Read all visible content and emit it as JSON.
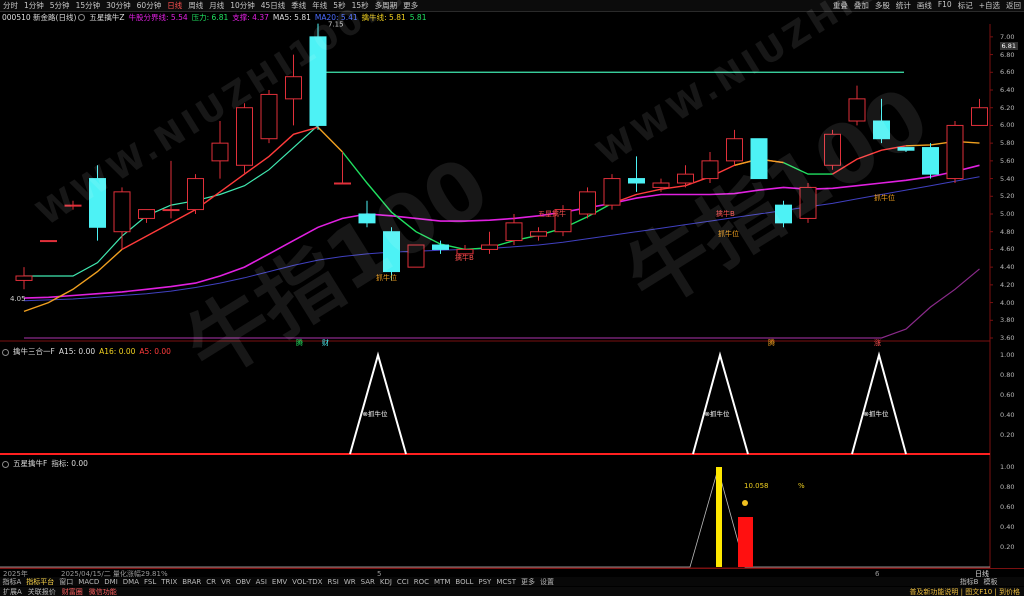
{
  "topbar": {
    "left_items": [
      "分时",
      "1分钟",
      "5分钟",
      "15分钟",
      "30分钟",
      "60分钟",
      "日线",
      "周线",
      "月线",
      "10分钟",
      "45日线",
      "季线",
      "年线",
      "5秒",
      "15秒",
      "多周期",
      "更多"
    ],
    "active": "日线",
    "right_items": [
      "重叠",
      "叠加",
      "多股",
      "统计",
      "画线",
      "F10",
      "标记",
      "+自选",
      "返回"
    ]
  },
  "info": {
    "code_name": "000510 新金路(日线)",
    "indicator_name": "五星擒牛Z",
    "resistance_label": "牛股分界线: 5.54",
    "pressure_label": "压力: 6.81",
    "support_label": "支撑: 4.37",
    "ma5_label": "MA5: 5.81",
    "ma20_label": "MA20: 5.41",
    "bull_line_label": "擒牛线: 5.81",
    "last_label": "5.81"
  },
  "colors": {
    "up": "#ff3b3b",
    "down": "#4df2f5",
    "green": "#20e060",
    "teal": "#40e8b0",
    "magenta": "#e020e0",
    "blue": "#4040c0",
    "orange": "#f0a020",
    "purple": "#8a2a8a"
  },
  "main_axis": [
    "7.00",
    "6.80",
    "6.60",
    "6.40",
    "6.20",
    "6.00",
    "5.80",
    "5.60",
    "5.40",
    "5.20",
    "5.00",
    "4.80",
    "4.60",
    "4.40",
    "4.20",
    "4.00",
    "3.80",
    "3.60"
  ],
  "price_badge": "6.81",
  "high_label": "7.15",
  "low_label": "4.05",
  "chart_labels": {
    "buy1": "抓牛位",
    "buy2": "抓牛位",
    "buy3": "抓牛位",
    "bull_b1": "擒牛B",
    "bull_b2": "擒牛B",
    "star": "五星擒牛"
  },
  "markers": [
    "腾",
    "财",
    "腾",
    "涨"
  ],
  "chart_data": [
    {
      "type": "candlestick",
      "title": "五星擒牛Z",
      "ylim": [
        3.6,
        7.1
      ],
      "candles": [
        {
          "o": 4.25,
          "h": 4.4,
          "l": 4.15,
          "c": 4.3
        },
        {
          "o": 4.7,
          "h": 4.7,
          "l": 4.7,
          "c": 4.7
        },
        {
          "o": 5.1,
          "h": 5.15,
          "l": 5.05,
          "c": 5.1
        },
        {
          "o": 5.4,
          "h": 5.55,
          "l": 4.7,
          "c": 4.85
        },
        {
          "o": 4.8,
          "h": 5.3,
          "l": 4.6,
          "c": 5.25
        },
        {
          "o": 4.95,
          "h": 5.0,
          "l": 4.9,
          "c": 5.05
        },
        {
          "o": 5.05,
          "h": 5.6,
          "l": 4.95,
          "c": 5.05
        },
        {
          "o": 5.05,
          "h": 5.45,
          "l": 5.0,
          "c": 5.4
        },
        {
          "o": 5.6,
          "h": 6.05,
          "l": 5.4,
          "c": 5.8
        },
        {
          "o": 5.55,
          "h": 6.25,
          "l": 5.45,
          "c": 6.2
        },
        {
          "o": 5.85,
          "h": 6.4,
          "l": 5.8,
          "c": 6.35
        },
        {
          "o": 6.3,
          "h": 6.8,
          "l": 6.0,
          "c": 6.55
        },
        {
          "o": 7.0,
          "h": 7.15,
          "l": 5.95,
          "c": 6.0
        },
        {
          "o": 5.35,
          "h": 5.7,
          "l": 5.35,
          "c": 5.35
        },
        {
          "o": 5.0,
          "h": 5.15,
          "l": 4.85,
          "c": 4.9
        },
        {
          "o": 4.8,
          "h": 4.85,
          "l": 4.25,
          "c": 4.35
        },
        {
          "o": 4.4,
          "h": 4.65,
          "l": 4.4,
          "c": 4.65
        },
        {
          "o": 4.65,
          "h": 4.7,
          "l": 4.55,
          "c": 4.6
        },
        {
          "o": 4.55,
          "h": 4.65,
          "l": 4.55,
          "c": 4.6
        },
        {
          "o": 4.6,
          "h": 4.8,
          "l": 4.55,
          "c": 4.65
        },
        {
          "o": 4.7,
          "h": 5.0,
          "l": 4.65,
          "c": 4.9
        },
        {
          "o": 4.75,
          "h": 4.85,
          "l": 4.7,
          "c": 4.8
        },
        {
          "o": 4.8,
          "h": 5.1,
          "l": 4.75,
          "c": 5.05
        },
        {
          "o": 5.0,
          "h": 5.3,
          "l": 4.95,
          "c": 5.25
        },
        {
          "o": 5.1,
          "h": 5.45,
          "l": 5.05,
          "c": 5.4
        },
        {
          "o": 5.4,
          "h": 5.65,
          "l": 5.25,
          "c": 5.35
        },
        {
          "o": 5.3,
          "h": 5.4,
          "l": 5.25,
          "c": 5.35
        },
        {
          "o": 5.35,
          "h": 5.55,
          "l": 5.3,
          "c": 5.45
        },
        {
          "o": 5.4,
          "h": 5.7,
          "l": 5.35,
          "c": 5.6
        },
        {
          "o": 5.6,
          "h": 5.95,
          "l": 5.55,
          "c": 5.85
        },
        {
          "o": 5.85,
          "h": 5.85,
          "l": 5.4,
          "c": 5.4
        },
        {
          "o": 5.1,
          "h": 5.15,
          "l": 4.85,
          "c": 4.9
        },
        {
          "o": 4.95,
          "h": 5.35,
          "l": 4.9,
          "c": 5.3
        },
        {
          "o": 5.55,
          "h": 5.95,
          "l": 5.5,
          "c": 5.9
        },
        {
          "o": 6.05,
          "h": 6.45,
          "l": 6.0,
          "c": 6.3
        },
        {
          "o": 6.05,
          "h": 6.3,
          "l": 5.8,
          "c": 5.85
        },
        {
          "o": 5.75,
          "h": 5.75,
          "l": 5.7,
          "c": 5.72
        },
        {
          "o": 5.75,
          "h": 5.8,
          "l": 5.4,
          "c": 5.45
        },
        {
          "o": 5.4,
          "h": 6.05,
          "l": 5.35,
          "c": 6.0
        },
        {
          "o": 6.0,
          "h": 6.3,
          "l": 6.0,
          "c": 6.2
        }
      ],
      "lines": {
        "bull_line_teal": [
          4.3,
          4.3,
          4.3,
          4.45,
          4.75,
          4.98,
          5.1,
          5.15,
          5.22,
          5.32,
          5.5,
          5.75,
          6.0,
          6.0,
          6.0,
          6.0,
          6.0,
          6.0,
          6.0,
          6.0,
          6.0,
          6.0,
          6.0,
          6.0,
          6.0,
          6.0,
          6.0,
          6.0,
          6.0,
          6.0,
          6.0,
          6.0,
          6.0,
          6.0,
          6.0,
          6.0,
          6.0,
          6.0,
          6.0,
          6.0
        ],
        "pressure_flat": [
          6.6,
          6.6,
          6.6,
          6.6,
          6.6,
          6.6,
          6.6,
          6.6,
          6.6,
          6.6,
          6.6,
          6.6,
          6.6,
          6.6,
          6.6,
          6.6,
          6.6,
          6.6,
          6.6,
          6.6,
          6.6,
          6.6,
          6.6,
          6.6,
          6.6,
          6.6,
          6.6,
          6.6,
          6.6,
          6.6,
          6.6,
          6.6,
          6.6,
          6.6,
          6.6,
          6.6,
          6.6,
          6.6,
          6.6,
          6.6
        ],
        "ma5": [
          3.9,
          4.0,
          4.15,
          4.35,
          4.6,
          4.75,
          4.9,
          5.05,
          5.25,
          5.45,
          5.65,
          5.9,
          5.98,
          5.7,
          5.35,
          5.02,
          4.8,
          4.66,
          4.6,
          4.62,
          4.7,
          4.76,
          4.84,
          4.97,
          5.12,
          5.22,
          5.28,
          5.32,
          5.42,
          5.55,
          5.62,
          5.58,
          5.45,
          5.45,
          5.62,
          5.72,
          5.77,
          5.78,
          5.82,
          5.8
        ],
        "ma20": [
          4.05,
          4.06,
          4.08,
          4.1,
          4.12,
          4.15,
          4.18,
          4.22,
          4.3,
          4.4,
          4.55,
          4.7,
          4.85,
          4.95,
          5.0,
          4.98,
          4.95,
          4.92,
          4.92,
          4.93,
          4.95,
          4.98,
          5.02,
          5.07,
          5.12,
          5.18,
          5.22,
          5.22,
          5.22,
          5.23,
          5.27,
          5.3,
          5.28,
          5.29,
          5.32,
          5.35,
          5.38,
          5.42,
          5.48,
          5.55
        ],
        "ma60": [
          4.02,
          4.03,
          4.04,
          4.06,
          4.08,
          4.1,
          4.13,
          4.17,
          4.22,
          4.28,
          4.35,
          4.42,
          4.48,
          4.52,
          4.55,
          4.57,
          4.58,
          4.59,
          4.6,
          4.61,
          4.63,
          4.65,
          4.68,
          4.72,
          4.76,
          4.8,
          4.84,
          4.88,
          4.92,
          4.96,
          5.0,
          5.04,
          5.08,
          5.12,
          5.17,
          5.22,
          5.27,
          5.32,
          5.37,
          5.42
        ],
        "support_purple": [
          3.6,
          3.6,
          3.6,
          3.6,
          3.6,
          3.6,
          3.6,
          3.6,
          3.6,
          3.6,
          3.6,
          3.6,
          3.6,
          3.6,
          3.6,
          3.6,
          3.6,
          3.6,
          3.6,
          3.6,
          3.6,
          3.6,
          3.6,
          3.6,
          3.6,
          3.6,
          3.6,
          3.6,
          3.6,
          3.6,
          3.6,
          3.6,
          3.6,
          3.6,
          3.6,
          3.6,
          3.7,
          3.95,
          4.15,
          4.38
        ]
      }
    },
    {
      "type": "line",
      "title": "擒牛三合一F",
      "ylim": [
        0,
        1
      ],
      "series": [
        {
          "name": "A15",
          "values_at_peaks": [
            {
              "i": 16,
              "v": 1.0
            },
            {
              "i": 32,
              "v": 1.0
            },
            {
              "i": 38,
              "v": 1.0
            }
          ]
        }
      ]
    },
    {
      "type": "bar",
      "title": "五星擒牛F",
      "ylim": [
        0,
        1
      ],
      "series": [
        {
          "name": "指标",
          "value": 0.0
        }
      ]
    }
  ],
  "panel2": {
    "title": "擒牛三合一F",
    "a15": "A15: 0.00",
    "a16": "A16: 0.00",
    "a5": "A5: 0.00",
    "peak_label": "抓牛位",
    "axis": [
      "1.00",
      "0.80",
      "0.60",
      "0.40",
      "0.20"
    ]
  },
  "panel3": {
    "title": "五星擒牛F",
    "value": "指标: 0.00",
    "annotation": "10.058",
    "percent": "%",
    "axis": [
      "1.00",
      "0.80",
      "0.60",
      "0.40",
      "0.20"
    ]
  },
  "datebar": {
    "year": "2025年",
    "date_info": "2025/04/15/二 量化涨幅29.81%",
    "tick_5": "5",
    "tick_6": "6",
    "period": "日线"
  },
  "tabs": [
    "指标A",
    "指标平台",
    "窗口",
    "MACD",
    "DMI",
    "DMA",
    "FSL",
    "TRIX",
    "BRAR",
    "CR",
    "VR",
    "OBV",
    "ASI",
    "EMV",
    "VOL-TDX",
    "RSI",
    "WR",
    "SAR",
    "KDJ",
    "CCI",
    "ROC",
    "MTM",
    "BOLL",
    "PSY",
    "MCST",
    "更多",
    "设置"
  ],
  "tabs_active": "指标平台",
  "tabs_right": [
    "指标B",
    "模板"
  ],
  "bottom": {
    "left": [
      "扩展A",
      "关联报价",
      "财富圈",
      "微信功能"
    ],
    "right": "普及新功能说明 | 图文F10 | 到价格"
  },
  "watermark": "牛指100",
  "watermark_url": "WWW.NIUZHI100.COM"
}
